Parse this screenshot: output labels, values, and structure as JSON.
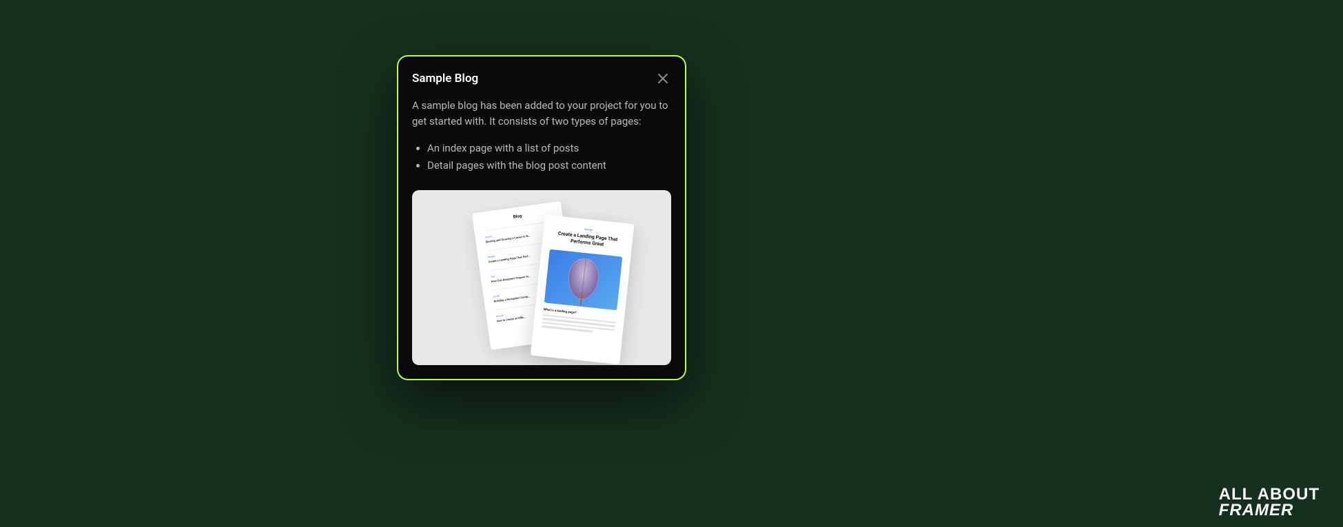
{
  "modal": {
    "title": "Sample Blog",
    "description": "A sample blog has been added to your project for you to get started with. It consists of two types of pages:",
    "bullets": [
      "An index page with a list of posts",
      "Detail pages with the blog post content"
    ]
  },
  "preview": {
    "index": {
      "title": "Blog",
      "rows": [
        {
          "category": "Career",
          "headline": "Starting and Growing a Career in W…"
        },
        {
          "category": "Design",
          "headline": "Create a Landing Page That Perf…"
        },
        {
          "category": "Tips",
          "headline": "How Can Designers Prepare fo…"
        },
        {
          "category": "Guide",
          "headline": "Building a Navigation Comp…"
        },
        {
          "category": "How-to",
          "headline": "How to Create an Effic…"
        }
      ]
    },
    "detail": {
      "category": "Design",
      "title": "Create a Landing Page That Performs Great",
      "subhead": "What is a landing page?"
    }
  },
  "brand": {
    "line1": "ALL ABOUT",
    "line2": "FRAMER"
  }
}
